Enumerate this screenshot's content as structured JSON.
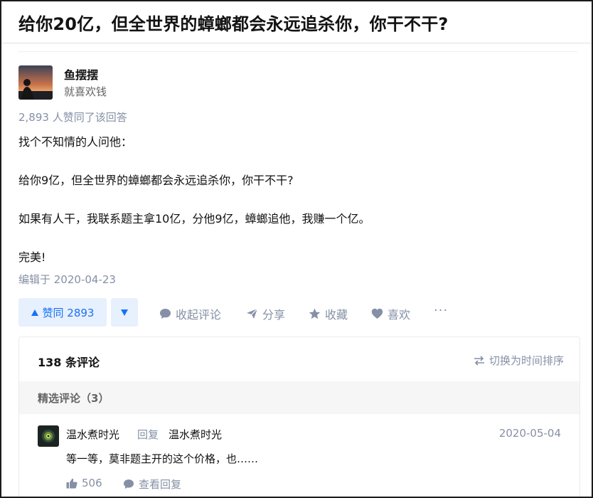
{
  "question": {
    "title": "给你20亿，但全世界的蟑螂都会永远追杀你，你干不干?"
  },
  "author": {
    "name": "鱼摆摆",
    "bio": "就喜欢钱"
  },
  "answer": {
    "voters_text": "2,893 人赞同了该回答",
    "paragraphs": [
      "找个不知情的人问他：",
      "给你9亿，但全世界的蟑螂都会永远追杀你，你干不干?",
      "如果有人干，我联系题主拿10亿，分他9亿，蟑螂追他，我赚一个亿。",
      "完美!"
    ],
    "edit_time": "编辑于 2020-04-23"
  },
  "actions": {
    "vote_label": "赞同 2893",
    "collapse_comments": "收起评论",
    "share": "分享",
    "collect": "收藏",
    "like": "喜欢",
    "more": "···"
  },
  "comments": {
    "count_label": "138 条评论",
    "switch_label": "切换为时间排序",
    "featured_label": "精选评论（3）",
    "items": [
      {
        "user": "温水煮时光",
        "reply_label": "回复",
        "reply_to": "温水煮时光",
        "date": "2020-05-04",
        "text": "等一等，莫非题主开的这个价格，也……",
        "likes": "506",
        "view_replies": "查看回复"
      }
    ]
  },
  "colors": {
    "accent": "#1772f6",
    "accent_bg": "#e7f0fd",
    "muted": "#8590a6",
    "text": "#121212"
  }
}
